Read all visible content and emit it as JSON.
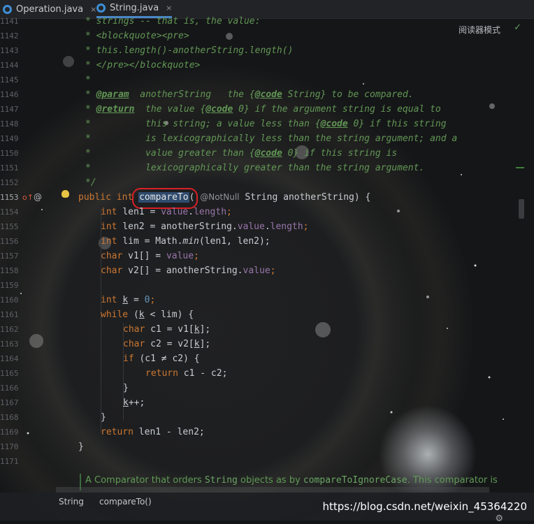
{
  "tabs": [
    {
      "label": "Operation.java",
      "close": "×",
      "icon": "class-icon"
    },
    {
      "label": "String.java",
      "close": "×",
      "icon": "class-icon"
    }
  ],
  "reader_mode": "阅读器模式",
  "check_icon": "✓",
  "gutter": {
    "lines": [
      "1141",
      "1142",
      "1143",
      "1144",
      "1145",
      "1146",
      "1147",
      "1148",
      "1149",
      "1150",
      "1151",
      "1152",
      "1153",
      "1154",
      "1155",
      "1156",
      "1157",
      "1158",
      "1159",
      "1160",
      "1161",
      "1162",
      "1163",
      "1164",
      "1165",
      "1166",
      "1167",
      "1168",
      "1169",
      "1170",
      "1171"
    ]
  },
  "code": {
    "l1141": "* strings -- that is, the value:",
    "l1142": "* <blockquote><pre>",
    "l1143": "* this.length()-anotherString.length()",
    "l1144": "* </pre></blockquote>",
    "l1145": "*",
    "l1146_star": "* ",
    "l1146_tag": "@param",
    "l1146_rest": "  anotherString   the {",
    "l1146_code": "@code",
    "l1146_end": " String} to be compared.",
    "l1147_star": "* ",
    "l1147_tag": "@return",
    "l1147_rest": "  the value {",
    "l1147_code": "@code",
    "l1147_end": " 0} if the argument string is equal to",
    "l1148_a": "*          this string; a value less than {",
    "l1148_code": "@code",
    "l1148_b": " 0} if this string",
    "l1149": "*          is lexicographically less than the string argument; and a",
    "l1150_a": "*          value greater than {",
    "l1150_code": "@code",
    "l1150_b": " 0} if this string is",
    "l1151": "*          lexicographically greater than the string argument.",
    "l1152": "*/",
    "sig_public": "public ",
    "sig_int": "int ",
    "sig_name": "compareTo",
    "sig_paren": "(",
    "sig_anno": "@NotNull",
    "sig_rest": " String anotherString) {",
    "l1154_kw": "int ",
    "l1154_a": "len1 = ",
    "l1154_f": "value",
    "l1154_b": ".",
    "l1154_f2": "length",
    "l1154_c": ";",
    "l1155_kw": "int ",
    "l1155_a": "len2 = anotherString.",
    "l1155_f": "value",
    "l1155_b": ".",
    "l1155_f2": "length",
    "l1155_c": ";",
    "l1156_kw": "int ",
    "l1156_a": "lim = Math.",
    "l1156_m": "min",
    "l1156_b": "(len1, len2);",
    "l1157_kw": "char ",
    "l1157_a": "v1[] = ",
    "l1157_f": "value",
    "l1157_b": ";",
    "l1158_kw": "char ",
    "l1158_a": "v2[] = anotherString.",
    "l1158_f": "value",
    "l1158_b": ";",
    "l1160_kw": "int ",
    "l1160_k": "k",
    "l1160_a": " = ",
    "l1160_n": "0",
    "l1160_b": ";",
    "l1161_kw": "while ",
    "l1161_a": "(",
    "l1161_k": "k",
    "l1161_b": " < lim) {",
    "l1162_kw": "char ",
    "l1162_a": "c1 = v1[",
    "l1162_k": "k",
    "l1162_b": "];",
    "l1163_kw": "char ",
    "l1163_a": "c2 = v2[",
    "l1163_k": "k",
    "l1163_b": "];",
    "l1164_kw": "if ",
    "l1164_a": "(c1 ≠ c2) {",
    "l1165_kw": "return ",
    "l1165_a": "c1 - c2;",
    "l1166": "}",
    "l1167_k": "k",
    "l1167_a": "++;",
    "l1168": "}",
    "l1169_kw": "return ",
    "l1169_a": "len1 - len2;",
    "l1170": "}"
  },
  "doc_popup": {
    "a": "A Comparator that orders ",
    "b": "String",
    "c": " objects as by ",
    "d": "compareToIgnoreCase",
    "e": ". This comparator is"
  },
  "gutter_icons": {
    "override": "o↑",
    "at": "@",
    "bulb": "bulb-icon"
  },
  "breadcrumb": [
    "String",
    "compareTo()"
  ],
  "watermark": "https://blog.csdn.net/weixin_45364220",
  "colors": {
    "keyword": "#cc7832",
    "field": "#9876aa",
    "doc": "#629755",
    "number": "#6897bb",
    "highlight_ring": "#d92025"
  }
}
